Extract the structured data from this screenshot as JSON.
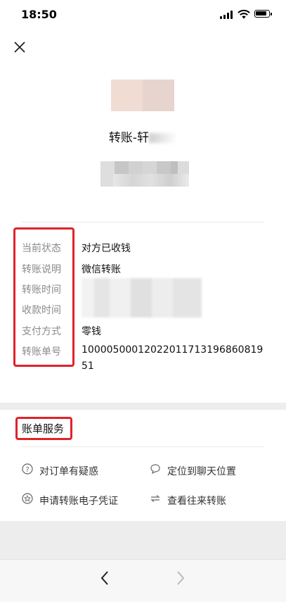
{
  "status_bar": {
    "time": "18:50"
  },
  "header": {
    "title": "转账-轩"
  },
  "details": [
    {
      "label": "当前状态",
      "value": "对方已收钱"
    },
    {
      "label": "转账说明",
      "value": "微信转账"
    },
    {
      "label": "转账时间",
      "value": ""
    },
    {
      "label": "收款时间",
      "value": ""
    },
    {
      "label": "支付方式",
      "value": "零钱"
    },
    {
      "label": "转账单号",
      "value": "1000050001202201171319686081951"
    }
  ],
  "services": {
    "title": "账单服务",
    "items": [
      {
        "icon": "question-circle-icon",
        "label": "对订单有疑惑"
      },
      {
        "icon": "chat-bubble-icon",
        "label": "定位到聊天位置"
      },
      {
        "icon": "star-badge-icon",
        "label": "申请转账电子凭证"
      },
      {
        "icon": "swap-arrows-icon",
        "label": "查看往来转账"
      }
    ]
  },
  "highlight_color": "#e0222a"
}
